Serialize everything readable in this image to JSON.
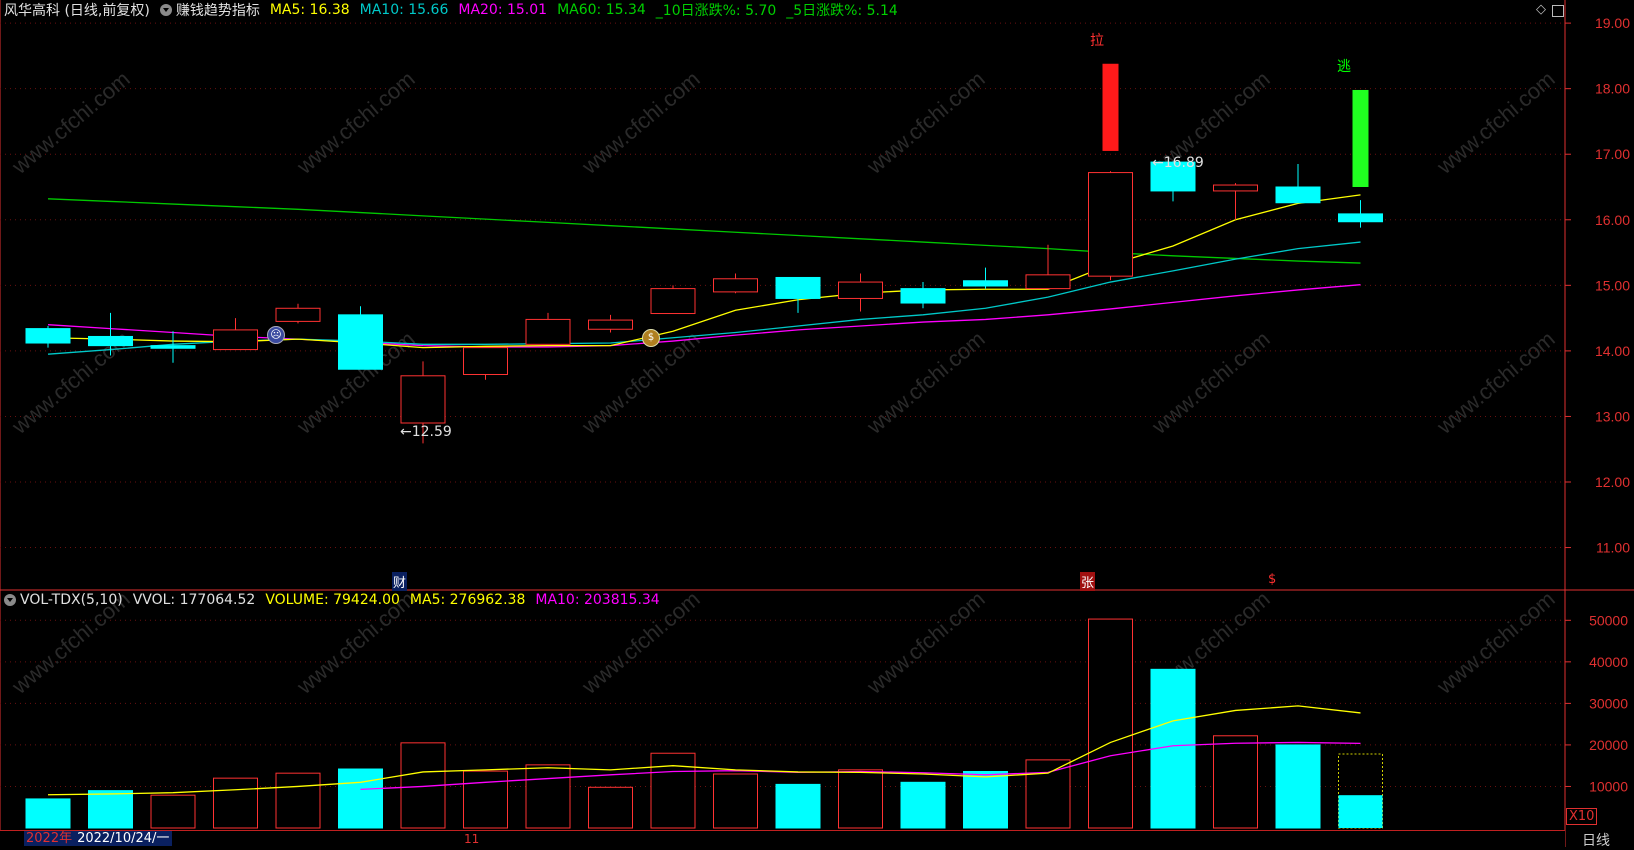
{
  "header": {
    "stock": "风华高科 (日线,前复权)",
    "indicator": "赚钱趋势指标",
    "ma5": "MA5: 16.38",
    "ma10": "MA10: 15.66",
    "ma20": "MA20: 15.01",
    "ma60": "MA60: 15.34",
    "chg10": "_10日涨跌%: 5.70",
    "chg5": "_5日涨跌%: 5.14"
  },
  "volume_header": {
    "title": "VOL-TDX(5,10)",
    "vvol": "VVOL: 177064.52",
    "volume": "VOLUME: 79424.00",
    "ma5": "MA5: 276962.38",
    "ma10": "MA10: 203815.34"
  },
  "annotations": {
    "la": "拉",
    "tao": "逃",
    "low": "←12.59",
    "high": "←16.89",
    "cai": "财",
    "zhang": "张",
    "s": "$"
  },
  "footer": {
    "year": "2022年",
    "date": "2022/10/24/一",
    "tick11": "11",
    "period": "日线",
    "x10": "X10"
  },
  "colors": {
    "up": "#ff3232",
    "down": "#00ffff",
    "ma5": "#ffff00",
    "ma10": "#00c8c8",
    "ma20": "#ff00ff",
    "ma60": "#00c800",
    "axis": "#e03030"
  },
  "chart_data": [
    {
      "type": "candlestick",
      "title": "风华高科 (日线,前复权)",
      "y_ticks": [
        "19.00",
        "18.00",
        "17.00",
        "16.00",
        "15.00",
        "14.00",
        "13.00",
        "12.00",
        "11.00"
      ],
      "ylim": [
        10.2,
        19.2
      ],
      "candles": [
        {
          "o": 14.34,
          "h": 14.38,
          "l": 14.05,
          "c": 14.12
        },
        {
          "o": 14.22,
          "h": 14.58,
          "l": 13.93,
          "c": 14.08
        },
        {
          "o": 14.08,
          "h": 14.3,
          "l": 13.82,
          "c": 14.04
        },
        {
          "o": 14.02,
          "h": 14.5,
          "l": 14.02,
          "c": 14.32
        },
        {
          "o": 14.45,
          "h": 14.72,
          "l": 14.42,
          "c": 14.65
        },
        {
          "o": 14.55,
          "h": 14.68,
          "l": 13.72,
          "c": 13.72
        },
        {
          "o": 12.9,
          "h": 13.84,
          "l": 12.59,
          "c": 13.62
        },
        {
          "o": 13.64,
          "h": 14.05,
          "l": 13.56,
          "c": 14.05
        },
        {
          "o": 14.1,
          "h": 14.58,
          "l": 14.1,
          "c": 14.48
        },
        {
          "o": 14.33,
          "h": 14.55,
          "l": 14.28,
          "c": 14.47
        },
        {
          "o": 14.57,
          "h": 15.0,
          "l": 14.57,
          "c": 14.95
        },
        {
          "o": 14.9,
          "h": 15.18,
          "l": 14.88,
          "c": 15.1
        },
        {
          "o": 15.12,
          "h": 15.12,
          "l": 14.58,
          "c": 14.8
        },
        {
          "o": 14.8,
          "h": 15.18,
          "l": 14.6,
          "c": 15.05
        },
        {
          "o": 14.95,
          "h": 15.05,
          "l": 14.65,
          "c": 14.73
        },
        {
          "o": 15.07,
          "h": 15.27,
          "l": 14.95,
          "c": 14.99
        },
        {
          "o": 14.95,
          "h": 15.62,
          "l": 14.95,
          "c": 15.16
        },
        {
          "o": 15.14,
          "h": 16.74,
          "l": 15.08,
          "c": 16.72
        },
        {
          "o": 16.88,
          "h": 16.89,
          "l": 16.28,
          "c": 16.44
        },
        {
          "o": 16.44,
          "h": 16.56,
          "l": 16.0,
          "c": 16.53
        },
        {
          "o": 16.5,
          "h": 16.85,
          "l": 16.26,
          "c": 16.26
        },
        {
          "o": 16.09,
          "h": 16.3,
          "l": 15.88,
          "c": 15.97
        }
      ],
      "ma5": [
        14.2,
        14.18,
        14.15,
        14.14,
        14.18,
        14.12,
        14.05,
        14.07,
        14.08,
        14.08,
        14.3,
        14.62,
        14.78,
        14.88,
        14.93,
        14.94,
        14.94,
        15.32,
        15.6,
        16.0,
        16.25,
        16.38
      ],
      "ma10": [
        13.95,
        14.02,
        14.1,
        14.15,
        14.18,
        14.15,
        14.1,
        14.1,
        14.11,
        14.12,
        14.2,
        14.28,
        14.38,
        14.48,
        14.55,
        14.65,
        14.82,
        15.05,
        15.22,
        15.4,
        15.56,
        15.66
      ],
      "ma20": [
        14.4,
        14.34,
        14.28,
        14.22,
        14.18,
        14.13,
        14.08,
        14.06,
        14.06,
        14.08,
        14.15,
        14.24,
        14.32,
        14.38,
        14.44,
        14.48,
        14.55,
        14.64,
        14.74,
        14.84,
        14.93,
        15.01
      ],
      "ma60": [
        16.32,
        16.28,
        16.24,
        16.2,
        16.16,
        16.11,
        16.06,
        16.01,
        15.96,
        15.91,
        15.86,
        15.81,
        15.76,
        15.71,
        15.66,
        15.61,
        15.56,
        15.5,
        15.45,
        15.41,
        15.37,
        15.34
      ]
    },
    {
      "type": "bar",
      "title": "VOL-TDX(5,10)",
      "y_ticks": [
        "50000",
        "40000",
        "30000",
        "20000",
        "10000"
      ],
      "ylim": [
        0,
        52000
      ],
      "values": [
        7000,
        9000,
        7900,
        12000,
        13200,
        14200,
        20500,
        13700,
        15200,
        9800,
        18000,
        13000,
        10500,
        14000,
        11000,
        13600,
        16400,
        50300,
        38200,
        22200,
        20000,
        17800
      ],
      "volume_up": [
        false,
        false,
        true,
        true,
        true,
        false,
        true,
        true,
        true,
        true,
        true,
        true,
        false,
        true,
        false,
        false,
        true,
        true,
        false,
        true,
        false,
        false
      ],
      "vol_ma5": [
        8000,
        8200,
        8500,
        9200,
        10000,
        11000,
        13500,
        14000,
        14500,
        14000,
        15000,
        14000,
        13500,
        13400,
        13000,
        12300,
        13200,
        20600,
        25800,
        28300,
        29400,
        27700
      ],
      "vol_ma10": [
        null,
        null,
        null,
        null,
        null,
        9300,
        10000,
        11000,
        11900,
        12800,
        13600,
        13800,
        13400,
        13600,
        13300,
        12800,
        13400,
        17400,
        19800,
        20400,
        20600,
        20380
      ]
    }
  ]
}
